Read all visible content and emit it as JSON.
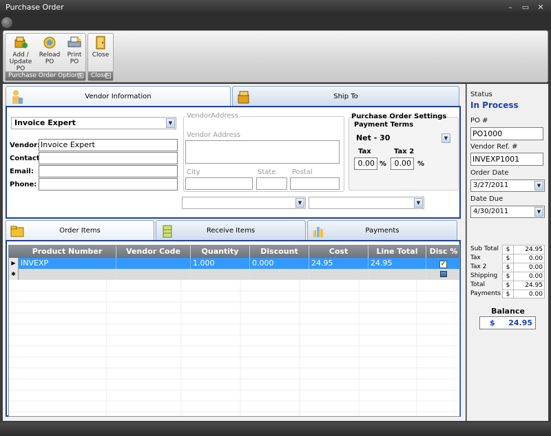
{
  "window": {
    "title": "Purchase Order",
    "minimize": "–",
    "restore": "▭",
    "close": "✕"
  },
  "ribbon": {
    "groups": [
      {
        "label": "Purchase Order Options",
        "buttons": [
          "Add / Update PO",
          "Reload PO",
          "Print PO"
        ]
      },
      {
        "label": "Close",
        "buttons": [
          "Close"
        ]
      }
    ],
    "add_update_l1": "Add /",
    "add_update_l2": "Update PO",
    "reload_l1": "Reload",
    "reload_l2": "PO",
    "print_l1": "Print",
    "print_l2": "PO",
    "close": "Close",
    "group1_label": "Purchase Order Options",
    "group2_label": "Close"
  },
  "top_tabs": {
    "vendor": "Vendor Information",
    "ship": "Ship To"
  },
  "vendor": {
    "selected_vendor": "Invoice Expert",
    "vendor_label": "Vendor:",
    "vendor_value": "Invoice Expert",
    "contact_label": "Contact:",
    "contact_value": "",
    "email_label": "Email:",
    "email_value": "",
    "phone_label": "Phone:",
    "phone_value": ""
  },
  "address": {
    "group_title": "VendorAddress",
    "vendor_address_placeholder": "Vendor Address",
    "city": "City",
    "state": "State",
    "postal": "Postal"
  },
  "po_settings": {
    "title": "Purchase Order Settings",
    "payment_terms_label": "Payment Terms",
    "payment_terms_value": "Net - 30",
    "tax_label": "Tax",
    "tax2_label": "Tax 2",
    "tax_value": "0.00",
    "tax2_value": "0.00",
    "percent": "%"
  },
  "bottom_tabs": {
    "order_items": "Order Items",
    "receive_items": "Receive Items",
    "payments": "Payments"
  },
  "grid": {
    "columns": [
      "Product Number",
      "Vendor Code",
      "Quantity",
      "Discount",
      "Cost",
      "Line Total",
      "Disc %"
    ],
    "rows": [
      {
        "product": "INVEXP",
        "vendor_code": "",
        "quantity": "1.000",
        "discount": "0.000",
        "cost": "24.95",
        "line_total": "24.95",
        "disc_check": "✓"
      }
    ],
    "selected_marker": "▶",
    "new_marker": "✱"
  },
  "sidebar": {
    "status_label": "Status",
    "status_value": "In Process",
    "po_label": "PO #",
    "po_value": "PO1000",
    "vendor_ref_label": "Vendor Ref. #",
    "vendor_ref_value": "INVEXP1001",
    "order_date_label": "Order Date",
    "order_date_value": "3/27/2011",
    "date_due_label": "Date Due",
    "date_due_value": "4/30/2011",
    "totals": [
      {
        "label": "Sub Total",
        "currency": "$",
        "value": "24.95"
      },
      {
        "label": "Tax",
        "currency": "$",
        "value": "0.00"
      },
      {
        "label": "Tax 2",
        "currency": "$",
        "value": "0.00"
      },
      {
        "label": "Shipping",
        "currency": "$",
        "value": "0.00"
      },
      {
        "label": "Total",
        "currency": "$",
        "value": "24.95"
      },
      {
        "label": "Payments",
        "currency": "$",
        "value": "0.00"
      }
    ],
    "balance_label": "Balance",
    "balance_currency": "$",
    "balance_value": "24.95"
  },
  "colors": {
    "accent": "#1e3e9a",
    "selected_row": "#3399ff",
    "status_text": "#1a3fc0"
  }
}
